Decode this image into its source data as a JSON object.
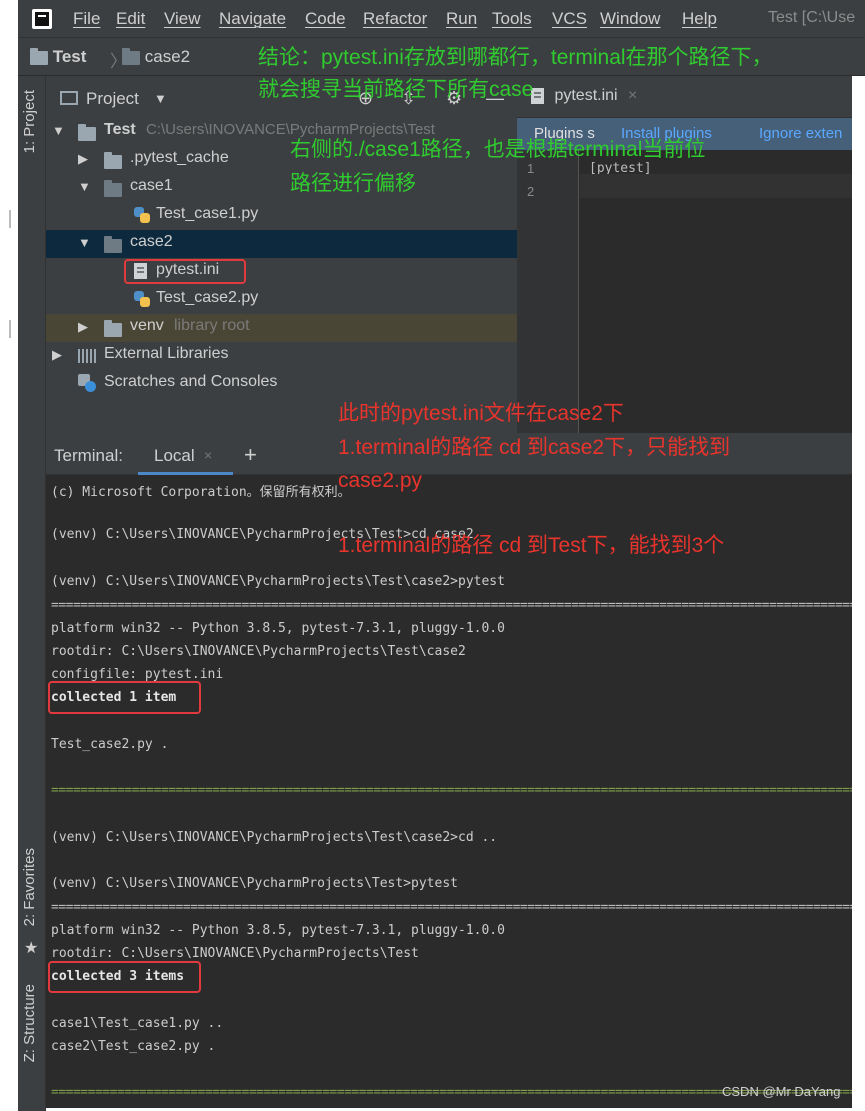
{
  "menubar": {
    "items": [
      "File",
      "Edit",
      "View",
      "Navigate",
      "Code",
      "Refactor",
      "Run",
      "Tools",
      "VCS",
      "Window",
      "Help"
    ],
    "window_title": "Test [C:\\Use"
  },
  "navbar": {
    "crumbs": [
      "Test",
      "case2"
    ]
  },
  "sidebar_tabs": {
    "project": "1: Project",
    "favorites": "2: Favorites",
    "structure": "Z: Structure"
  },
  "project_panel": {
    "title": "Project",
    "tree": [
      {
        "label": "Test",
        "hint": "C:\\Users\\INOVANCE\\PycharmProjects\\Test"
      },
      {
        "label": ".pytest_cache"
      },
      {
        "label": "case1"
      },
      {
        "label": "Test_case1.py"
      },
      {
        "label": "case2"
      },
      {
        "label": "pytest.ini"
      },
      {
        "label": "Test_case2.py"
      },
      {
        "label": "venv",
        "hint": "library root"
      },
      {
        "label": "External Libraries"
      },
      {
        "label": "Scratches and Consoles"
      }
    ]
  },
  "editor": {
    "tab_label": "pytest.ini",
    "plugin_bar": {
      "text": "Plugins s",
      "install": "Install plugins",
      "ignore": "Ignore exten"
    },
    "line_numbers": [
      "1",
      "2"
    ],
    "code": "[pytest]"
  },
  "terminal": {
    "title": "Terminal:",
    "tab_label": "Local",
    "lines": [
      "(c) Microsoft Corporation。保留所有权利。",
      "(venv) C:\\Users\\INOVANCE\\PycharmProjects\\Test>cd case2",
      "(venv) C:\\Users\\INOVANCE\\PycharmProjects\\Test\\case2>pytest",
      "platform win32 -- Python 3.8.5, pytest-7.3.1, pluggy-1.0.0",
      "rootdir: C:\\Users\\INOVANCE\\PycharmProjects\\Test\\case2",
      "configfile: pytest.ini",
      "collected 1 item",
      "Test_case2.py .",
      "(venv) C:\\Users\\INOVANCE\\PycharmProjects\\Test\\case2>cd ..",
      "(venv) C:\\Users\\INOVANCE\\PycharmProjects\\Test>pytest",
      "platform win32 -- Python 3.8.5, pytest-7.3.1, pluggy-1.0.0",
      "rootdir: C:\\Users\\INOVANCE\\PycharmProjects\\Test",
      "collected 3 items",
      "case1\\Test_case1.py ..",
      "case2\\Test_case2.py ."
    ],
    "separator": "==============================================================================================================================================================================================================",
    "green_separator": "=============================================================================================================================================================================================================="
  },
  "annotations": {
    "green_1a": "结论：pytest.ini存放到哪都行，terminal在那个路径下，",
    "green_1b": "就会搜寻当前路径下所有case",
    "green_2a": "右侧的./case1路径，也是根据terminal当前位",
    "green_2b": "路径进行偏移",
    "red_1": "此时的pytest.ini文件在case2下",
    "red_2a": "1.terminal的路径 cd 到case2下，只能找到",
    "red_2b": "case2.py",
    "red_3": "1.terminal的路径 cd 到Test下，能找到3个"
  },
  "watermark": "CSDN @Mr DaYang",
  "colors": {
    "panel": "#3c3f41",
    "editor": "#2b2b2b",
    "selection": "#0d293e",
    "annotation_green": "#2fcb2f",
    "annotation_red": "#e8342c",
    "highlight_box": "#e0393e"
  }
}
